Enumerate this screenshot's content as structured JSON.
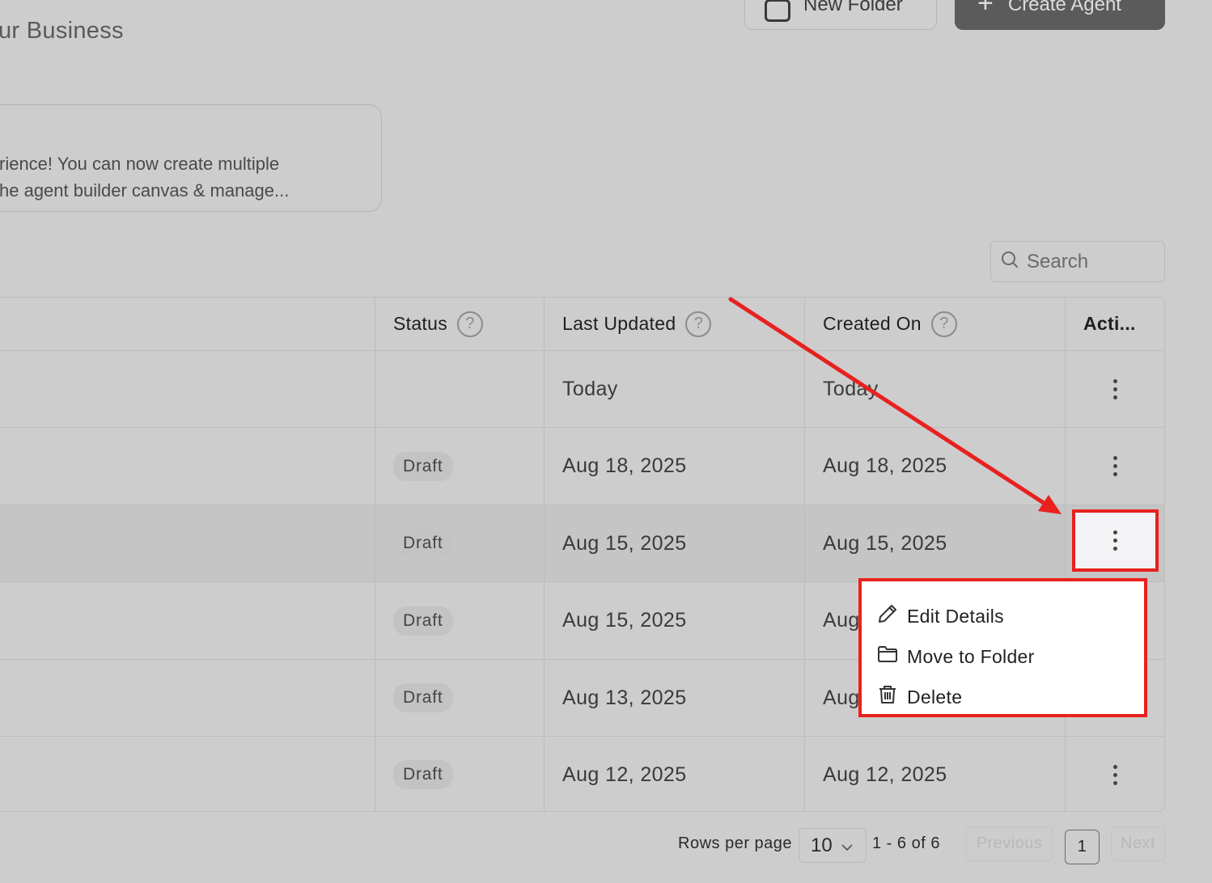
{
  "header": {
    "title": "ur Business",
    "new_folder_label": "New Folder",
    "create_agent_label": "Create Agent"
  },
  "banner": {
    "line1": "rience! You can now create multiple",
    "line2": "he agent builder canvas & manage..."
  },
  "search": {
    "placeholder": "Search"
  },
  "table": {
    "columns": {
      "status": "Status",
      "last_updated": "Last Updated",
      "created_on": "Created On",
      "actions": "Acti..."
    },
    "rows": [
      {
        "status": "",
        "last_updated": "Today",
        "created_on": "Today"
      },
      {
        "status": "Draft",
        "last_updated": "Aug 18, 2025",
        "created_on": "Aug 18, 2025"
      },
      {
        "status": "Draft",
        "last_updated": "Aug 15, 2025",
        "created_on": "Aug 15, 2025"
      },
      {
        "status": "Draft",
        "last_updated": "Aug 15, 2025",
        "created_on": "Aug"
      },
      {
        "status": "Draft",
        "last_updated": "Aug 13, 2025",
        "created_on": "Aug"
      },
      {
        "status": "Draft",
        "last_updated": "Aug 12, 2025",
        "created_on": "Aug 12, 2025"
      }
    ]
  },
  "context_menu": {
    "items": [
      {
        "label": "Edit Details",
        "icon": "pencil-icon"
      },
      {
        "label": "Move to Folder",
        "icon": "folder-icon"
      },
      {
        "label": "Delete",
        "icon": "trash-icon"
      }
    ]
  },
  "pagination": {
    "rows_per_page_label": "Rows per page",
    "rows_per_page_value": "10",
    "range": "1 - 6 of 6",
    "previous": "Previous",
    "page": "1",
    "next": "Next"
  },
  "colors": {
    "background": "#cdcdcd",
    "highlight_red": "#e8211f",
    "create_button": "#5b5b5b"
  }
}
